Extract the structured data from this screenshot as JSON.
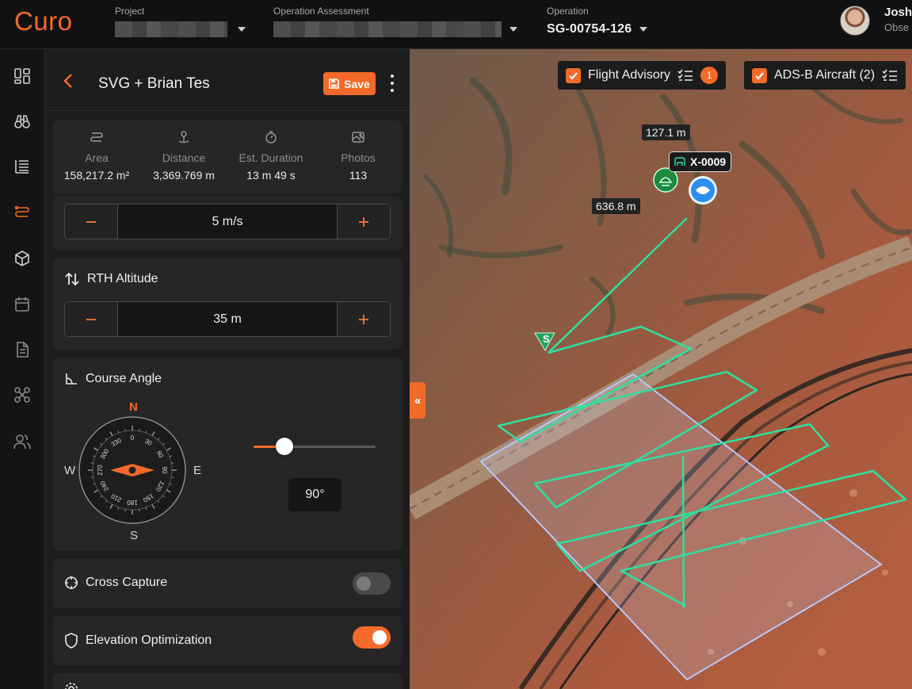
{
  "app": {
    "logo": "Curo"
  },
  "topbar": {
    "project": {
      "label": "Project",
      "value": ""
    },
    "assessment": {
      "label": "Operation Assessment",
      "value": ""
    },
    "operation": {
      "label": "Operation",
      "value": "SG-00754-126"
    },
    "user": {
      "name": "Josh",
      "role": "Obse"
    }
  },
  "rail": {
    "items": [
      "dashboard-icon",
      "binoculars-icon",
      "checklist-icon",
      "flight-path-icon",
      "cube-icon",
      "calendar-icon",
      "document-icon",
      "drone-icon",
      "users-icon"
    ],
    "active": "flight-path-icon"
  },
  "panel": {
    "title": "SVG + Brian Tes",
    "save_label": "Save",
    "stats": [
      {
        "icon": "area-icon",
        "label": "Area",
        "value": "158,217.2 m²"
      },
      {
        "icon": "distance-icon",
        "label": "Distance",
        "value": "3,369.769 m"
      },
      {
        "icon": "timer-icon",
        "label": "Est. Duration",
        "value": "13 m 49 s"
      },
      {
        "icon": "photos-icon",
        "label": "Photos",
        "value": "113"
      }
    ],
    "speed": {
      "value": "5 m/s"
    },
    "rth": {
      "title": "RTH Altitude",
      "value": "35 m"
    },
    "course": {
      "title": "Course Angle",
      "north": "N",
      "south": "S",
      "east": "E",
      "west": "W",
      "ticks": [
        "0",
        "30",
        "60",
        "90",
        "120",
        "150",
        "180",
        "210",
        "240",
        "270",
        "300",
        "330"
      ],
      "slider_fraction": 0.25,
      "angle": "90°"
    },
    "cross_capture": {
      "label": "Cross Capture",
      "enabled": false
    },
    "elevation": {
      "label": "Elevation Optimization",
      "enabled": true
    }
  },
  "map": {
    "flight_advisory": {
      "label": "Flight Advisory",
      "count": "1"
    },
    "adsb": {
      "label": "ADS-B Aircraft (2)"
    },
    "distance_top": "127.1 m",
    "distance_mid": "636.8 m",
    "drone_id": "X-0009",
    "start_marker": "S"
  },
  "colors": {
    "accent": "#f36a2a",
    "path": "#2ee0a0",
    "area": "#b8c8ff"
  }
}
